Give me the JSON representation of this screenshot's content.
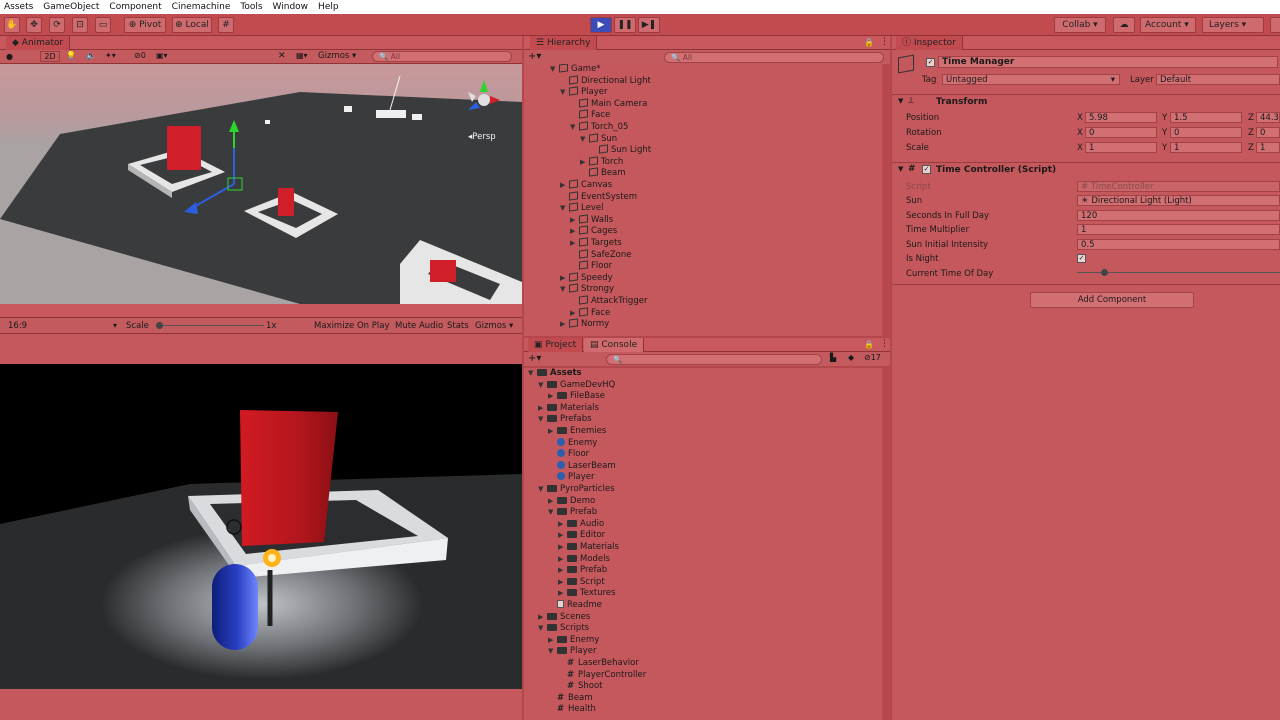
{
  "menu": [
    "Assets",
    "GameObject",
    "Component",
    "Cinemachine",
    "Tools",
    "Window",
    "Help"
  ],
  "toolbar": {
    "pivot": "Pivot",
    "local": "Local",
    "collab": "Collab",
    "account": "Account",
    "layers": "Layers"
  },
  "scene": {
    "tab": "Animator",
    "mode_2d": "2D",
    "gizmos": "Gizmos",
    "search_placeholder": "All",
    "persp": "Persp",
    "layer_count": "0"
  },
  "game": {
    "aspect": "16:9",
    "scale_label": "Scale",
    "scale_value": "1x",
    "maximize": "Maximize On Play",
    "mute": "Mute Audio",
    "stats": "Stats",
    "gizmos": "Gizmos"
  },
  "hierarchy": {
    "tab": "Hierarchy",
    "search_placeholder": "All",
    "items": [
      {
        "label": "Game*",
        "depth": 0,
        "expanded": true,
        "icon": "unity"
      },
      {
        "label": "Directional Light",
        "depth": 1,
        "icon": "cube"
      },
      {
        "label": "Player",
        "depth": 1,
        "expanded": true,
        "icon": "cube"
      },
      {
        "label": "Main Camera",
        "depth": 2,
        "icon": "cube"
      },
      {
        "label": "Face",
        "depth": 2,
        "icon": "cube"
      },
      {
        "label": "Torch_05",
        "depth": 2,
        "expanded": true,
        "icon": "cube"
      },
      {
        "label": "Sun",
        "depth": 3,
        "expanded": true,
        "icon": "cube"
      },
      {
        "label": "Sun Light",
        "depth": 4,
        "icon": "cube"
      },
      {
        "label": "Torch",
        "depth": 3,
        "collapsed": true,
        "icon": "cube"
      },
      {
        "label": "Beam",
        "depth": 3,
        "icon": "cube"
      },
      {
        "label": "Canvas",
        "depth": 1,
        "collapsed": true,
        "icon": "cube"
      },
      {
        "label": "EventSystem",
        "depth": 1,
        "icon": "cube"
      },
      {
        "label": "Level",
        "depth": 1,
        "expanded": true,
        "icon": "cube"
      },
      {
        "label": "Walls",
        "depth": 2,
        "collapsed": true,
        "icon": "cube"
      },
      {
        "label": "Cages",
        "depth": 2,
        "collapsed": true,
        "icon": "cube"
      },
      {
        "label": "Targets",
        "depth": 2,
        "collapsed": true,
        "icon": "cube"
      },
      {
        "label": "SafeZone",
        "depth": 2,
        "icon": "cube"
      },
      {
        "label": "Floor",
        "depth": 2,
        "icon": "cube"
      },
      {
        "label": "Speedy",
        "depth": 1,
        "collapsed": true,
        "icon": "cube"
      },
      {
        "label": "Strongy",
        "depth": 1,
        "expanded": true,
        "icon": "cube"
      },
      {
        "label": "AttackTrigger",
        "depth": 2,
        "icon": "cube"
      },
      {
        "label": "Face",
        "depth": 2,
        "collapsed": true,
        "icon": "cube"
      },
      {
        "label": "Normy",
        "depth": 1,
        "collapsed": true,
        "icon": "cube"
      }
    ]
  },
  "project": {
    "tab": "Project",
    "console_tab": "Console",
    "count": "17",
    "items": [
      {
        "label": "Assets",
        "depth": 0,
        "expanded": true,
        "icon": "folder",
        "bold": true
      },
      {
        "label": "GameDevHQ",
        "depth": 1,
        "expanded": true,
        "icon": "folder"
      },
      {
        "label": "FileBase",
        "depth": 2,
        "collapsed": true,
        "icon": "folder"
      },
      {
        "label": "Materials",
        "depth": 1,
        "collapsed": true,
        "icon": "folder"
      },
      {
        "label": "Prefabs",
        "depth": 1,
        "expanded": true,
        "icon": "folder"
      },
      {
        "label": "Enemies",
        "depth": 2,
        "collapsed": true,
        "icon": "folder"
      },
      {
        "label": "Enemy",
        "depth": 2,
        "icon": "prefab"
      },
      {
        "label": "Floor",
        "depth": 2,
        "icon": "prefab"
      },
      {
        "label": "LaserBeam",
        "depth": 2,
        "icon": "prefab"
      },
      {
        "label": "Player",
        "depth": 2,
        "icon": "prefab"
      },
      {
        "label": "PyroParticles",
        "depth": 1,
        "expanded": true,
        "icon": "folder"
      },
      {
        "label": "Demo",
        "depth": 2,
        "collapsed": true,
        "icon": "folder"
      },
      {
        "label": "Prefab",
        "depth": 2,
        "expanded": true,
        "icon": "folder"
      },
      {
        "label": "Audio",
        "depth": 3,
        "collapsed": true,
        "icon": "folder"
      },
      {
        "label": "Editor",
        "depth": 3,
        "collapsed": true,
        "icon": "folder"
      },
      {
        "label": "Materials",
        "depth": 3,
        "collapsed": true,
        "icon": "folder"
      },
      {
        "label": "Models",
        "depth": 3,
        "collapsed": true,
        "icon": "folder"
      },
      {
        "label": "Prefab",
        "depth": 3,
        "collapsed": true,
        "icon": "folder"
      },
      {
        "label": "Script",
        "depth": 3,
        "collapsed": true,
        "icon": "folder"
      },
      {
        "label": "Textures",
        "depth": 3,
        "collapsed": true,
        "icon": "folder"
      },
      {
        "label": "Readme",
        "depth": 2,
        "icon": "doc"
      },
      {
        "label": "Scenes",
        "depth": 1,
        "collapsed": true,
        "icon": "folder"
      },
      {
        "label": "Scripts",
        "depth": 1,
        "expanded": true,
        "icon": "folder"
      },
      {
        "label": "Enemy",
        "depth": 2,
        "collapsed": true,
        "icon": "folder"
      },
      {
        "label": "Player",
        "depth": 2,
        "expanded": true,
        "icon": "folder"
      },
      {
        "label": "LaserBehavior",
        "depth": 3,
        "icon": "script"
      },
      {
        "label": "PlayerController",
        "depth": 3,
        "icon": "script"
      },
      {
        "label": "Shoot",
        "depth": 3,
        "icon": "script"
      },
      {
        "label": "Beam",
        "depth": 2,
        "icon": "script"
      },
      {
        "label": "Health",
        "depth": 2,
        "icon": "script"
      }
    ]
  },
  "inspector": {
    "tab": "Inspector",
    "object_name": "Time Manager",
    "tag_label": "Tag",
    "tag_value": "Untagged",
    "layer_label": "Layer",
    "layer_value": "Default",
    "transform": {
      "title": "Transform",
      "position_label": "Position",
      "position": {
        "x": "5.98",
        "y": "1.5",
        "z": "44.3"
      },
      "rotation_label": "Rotation",
      "rotation": {
        "x": "0",
        "y": "0",
        "z": "0"
      },
      "scale_label": "Scale",
      "scale": {
        "x": "1",
        "y": "1",
        "z": "1"
      }
    },
    "script": {
      "title": "Time Controller (Script)",
      "script_label": "Script",
      "script_value": "TimeController",
      "sun_label": "Sun",
      "sun_value": "Directional Light (Light)",
      "seconds_label": "Seconds In Full Day",
      "seconds_value": "120",
      "multiplier_label": "Time Multiplier",
      "multiplier_value": "1",
      "intensity_label": "Sun Initial Intensity",
      "intensity_value": "0.5",
      "night_label": "Is Night",
      "current_label": "Current Time Of Day",
      "current_value_fraction": 0.12
    },
    "add_component": "Add Component"
  }
}
